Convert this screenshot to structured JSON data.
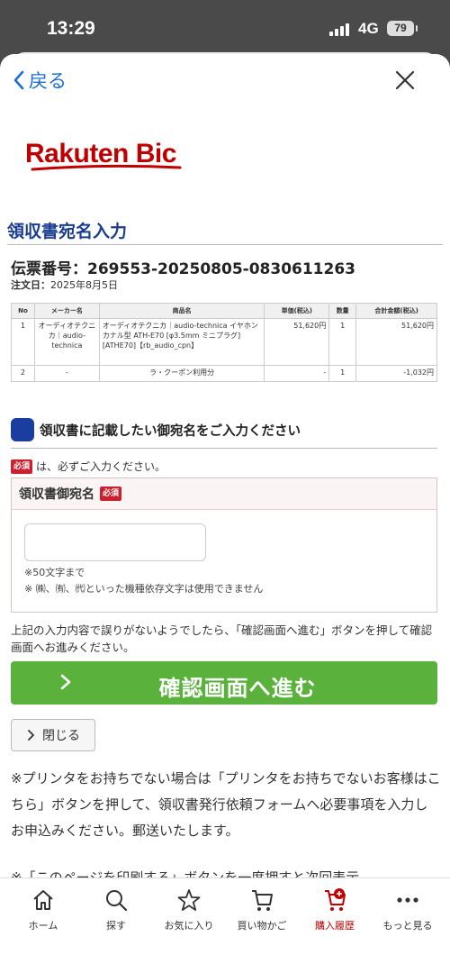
{
  "status": {
    "time": "13:29",
    "network": "4G",
    "battery": "79"
  },
  "topbar": {
    "back_label": "戻る"
  },
  "brand": {
    "name": "Rakuten Bic"
  },
  "page": {
    "title": "領収書宛名入力",
    "slip_label": "伝票番号：",
    "slip_number": "269553-20250805-0830611263",
    "order_date_label": "注文日：",
    "order_date": "2025年8月5日"
  },
  "table": {
    "headers": [
      "No",
      "メーカー名",
      "商品名",
      "単価(税込)",
      "数量",
      "合計金額(税込)"
    ],
    "rows": [
      [
        "1",
        "オーディオテクニカ｜audio-technica",
        "オーディオテクニカ｜audio-technica イヤホン カナル型 ATH-E70 [φ3.5mm ミニプラグ][ATHE70]【rb_audio_cpn】",
        "51,620円",
        "1",
        "51,620円"
      ],
      [
        "2",
        "-",
        "ラ・クーポン利用分",
        "-",
        "1",
        "-1,032円"
      ]
    ]
  },
  "form": {
    "section_title": "領収書に記載したい御宛名をご入力ください",
    "required_badge": "必須",
    "required_note": "は、必ずご入力ください。",
    "field_label": "領収書御宛名",
    "field_value": "",
    "field_placeholder": "",
    "hint_1": "※50文字まで",
    "hint_2": "※ ㈱、㈲、㈹といった機種依存文字は使用できません"
  },
  "actions": {
    "instruction": "上記の入力内容で誤りがないようでしたら、「確認画面へ進む」ボタンを押して確認画面へお進みください。",
    "confirm_label": "確認画面へ進む",
    "close_label": "閉じる"
  },
  "notes": {
    "printer_note": "※プリンタをお持ちでない場合は「プリンタをお持ちでないお客様はこちら」ボタンを押して、領収書発行依頼フォームへ必要事項を入力しお申込みください。郵送いたします。",
    "print_note_partial": "※「このページを印刷する」ボタンを一度押すと次回表示"
  },
  "nav": {
    "items": [
      {
        "label": "ホーム",
        "icon": "home-icon"
      },
      {
        "label": "探す",
        "icon": "search-icon"
      },
      {
        "label": "お気に入り",
        "icon": "star-icon"
      },
      {
        "label": "買い物かご",
        "icon": "cart-icon"
      },
      {
        "label": "購入履歴",
        "icon": "history-icon",
        "active": true
      },
      {
        "label": "もっと見る",
        "icon": "more-icon"
      }
    ]
  },
  "colors": {
    "brand_red": "#bf0000",
    "link_blue": "#1a6fd0",
    "heading_blue": "#1a3d8f",
    "confirm_green": "#5ab23c",
    "badge_red": "#cc1f2f"
  }
}
